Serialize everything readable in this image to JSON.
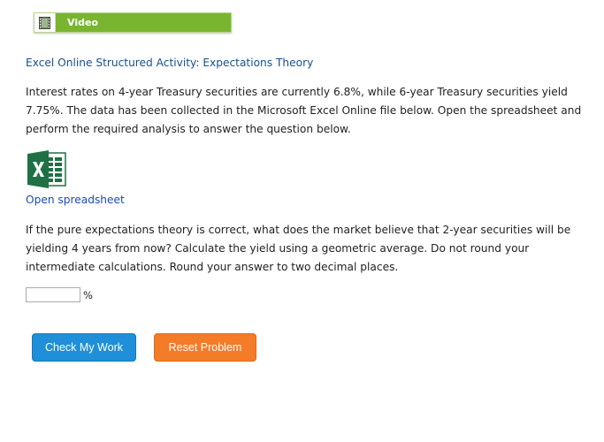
{
  "video": {
    "label": "Video",
    "icon": "film-icon"
  },
  "activity": {
    "title": "Excel Online Structured Activity: Expectations Theory"
  },
  "intro": {
    "lines": [
      "Interest rates on 4-year Treasury securities are currently 6.8%, while 6-year Treasury securities yield",
      "7.75%. The data has been collected in the Microsoft Excel Online file below. Open the spreadsheet and",
      "perform the required analysis to answer the question below."
    ]
  },
  "spreadsheet": {
    "icon": "excel-icon",
    "icon_color": "#1f7145",
    "link_label": "Open spreadsheet"
  },
  "question": {
    "lines": [
      "If the pure expectations theory is correct, what does the market believe that 2-year securities will be",
      "yielding 4 years from now? Calculate the yield using a geometric average. Do not round your",
      "intermediate calculations. Round your answer to two decimal places."
    ]
  },
  "answer": {
    "value": "",
    "unit": "%"
  },
  "buttons": {
    "check_label": "Check My Work",
    "check_color": "#1e8fd8",
    "reset_label": "Reset Problem",
    "reset_color": "#f47b27"
  },
  "colors": {
    "video_bar": "#7ab530",
    "title_text": "#1a4f8a",
    "link_text": "#1a49b8"
  }
}
